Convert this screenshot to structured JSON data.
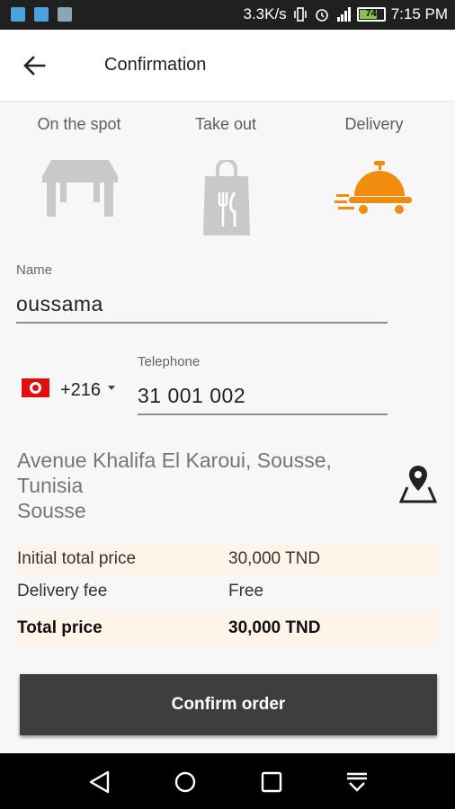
{
  "status_bar": {
    "speed": "3.3K/s",
    "battery": "74",
    "time": "7:15 PM"
  },
  "header": {
    "title": "Confirmation"
  },
  "order_types": [
    {
      "label": "On the spot",
      "icon": "table-icon",
      "selected": false
    },
    {
      "label": "Take out",
      "icon": "takeout-bag-icon",
      "selected": false
    },
    {
      "label": "Delivery",
      "icon": "delivery-cloche-icon",
      "selected": true
    }
  ],
  "form": {
    "name_label": "Name",
    "name_value": "oussama",
    "country_code": "+216",
    "telephone_label": "Telephone",
    "telephone_value": "31 001 002"
  },
  "address": {
    "line1": "Avenue Khalifa El Karoui, Sousse,",
    "line2": "Tunisia",
    "line3": "Sousse"
  },
  "summary": {
    "initial_label": "Initial total price",
    "initial_value": "30,000 TND",
    "fee_label": "Delivery fee",
    "fee_value": "Free",
    "total_label": "Total price",
    "total_value": "30,000 TND"
  },
  "actions": {
    "confirm_label": "Confirm order"
  },
  "colors": {
    "accent": "#f28c0f",
    "inactive_icon": "#c9c9c9",
    "button": "#3e3e3e",
    "price_row_shade": "#fff4ea"
  }
}
